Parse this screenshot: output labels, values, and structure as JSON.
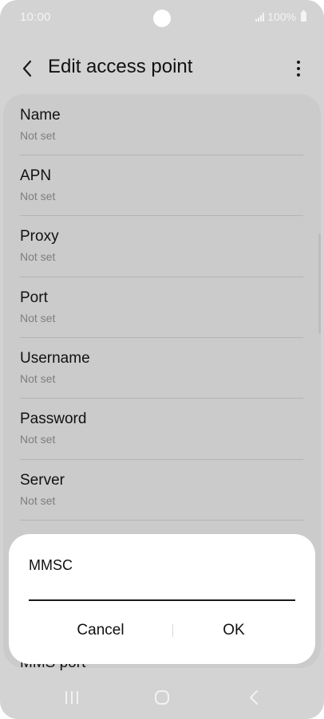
{
  "status_bar": {
    "time": "10:00",
    "battery": "100%"
  },
  "app_bar": {
    "title": "Edit access point",
    "back_icon": "chevron-left-icon",
    "more_icon": "more-vertical-icon"
  },
  "settings": [
    {
      "label": "Name",
      "value": "Not set"
    },
    {
      "label": "APN",
      "value": "Not set"
    },
    {
      "label": "Proxy",
      "value": "Not set"
    },
    {
      "label": "Port",
      "value": "Not set"
    },
    {
      "label": "Username",
      "value": "Not set"
    },
    {
      "label": "Password",
      "value": "Not set"
    },
    {
      "label": "Server",
      "value": "Not set"
    },
    {
      "label": "MMS port",
      "value": ""
    }
  ],
  "dialog": {
    "title": "MMSC",
    "input_value": "",
    "cancel_label": "Cancel",
    "ok_label": "OK"
  },
  "colors": {
    "dimmed_background": "#d3d3d3",
    "list_card": "#cbcbcb",
    "dialog_background": "#ffffff",
    "secondary_text": "#7e7e7e"
  }
}
